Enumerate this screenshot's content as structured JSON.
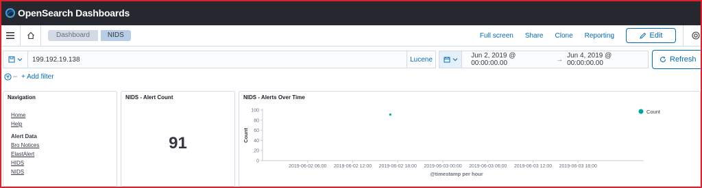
{
  "app": {
    "logo_text": "OpenSearch Dashboards"
  },
  "nav": {
    "breadcrumbs": [
      "Dashboard",
      "NIDS"
    ],
    "actions": [
      "Full screen",
      "Share",
      "Clone",
      "Reporting"
    ],
    "edit_label": "Edit"
  },
  "query": {
    "value": "199.192.19.138",
    "language": "Lucene"
  },
  "time": {
    "start": "Jun 2, 2019 @ 00:00:00.00",
    "arrow": "→",
    "end": "Jun 4, 2019 @ 00:00:00.00",
    "refresh_label": "Refresh"
  },
  "filter": {
    "add_label": "+ Add filter"
  },
  "panels": {
    "navigation": {
      "title": "Navigation",
      "links_top": [
        "Home",
        "Help"
      ],
      "section": "Alert Data",
      "links_bottom": [
        "Bro Notices",
        "ElastAlert",
        "HIDS",
        "NIDS"
      ]
    },
    "alert_count": {
      "title": "NIDS - Alert Count",
      "value": "91"
    },
    "alerts_over_time": {
      "title": "NIDS - Alerts Over Time"
    }
  },
  "chart_data": {
    "type": "scatter",
    "title": "NIDS - Alerts Over Time",
    "xlabel": "@timestamp per hour",
    "ylabel": "Count",
    "x_ticks": [
      "2019-06-02 06:00",
      "2019-06-02 12:00",
      "2019-06-02 18:00",
      "2019-06-03 00:00",
      "2019-06-03 06:00",
      "2019-06-03 12:00",
      "2019-06-03 18:00"
    ],
    "y_ticks": [
      0,
      20,
      40,
      60,
      80,
      100
    ],
    "ylim": [
      0,
      100
    ],
    "x_range_hours": [
      0,
      48
    ],
    "series": [
      {
        "name": "Count",
        "color": "#00a69b",
        "points": [
          {
            "x": "2019-06-02 17:00",
            "x_hours": 17,
            "y": 91
          }
        ]
      }
    ],
    "legend": "top-right",
    "grid": false
  },
  "colors": {
    "topbar": "#25282f",
    "accent": "#006bb8",
    "series": "#00a69b"
  }
}
